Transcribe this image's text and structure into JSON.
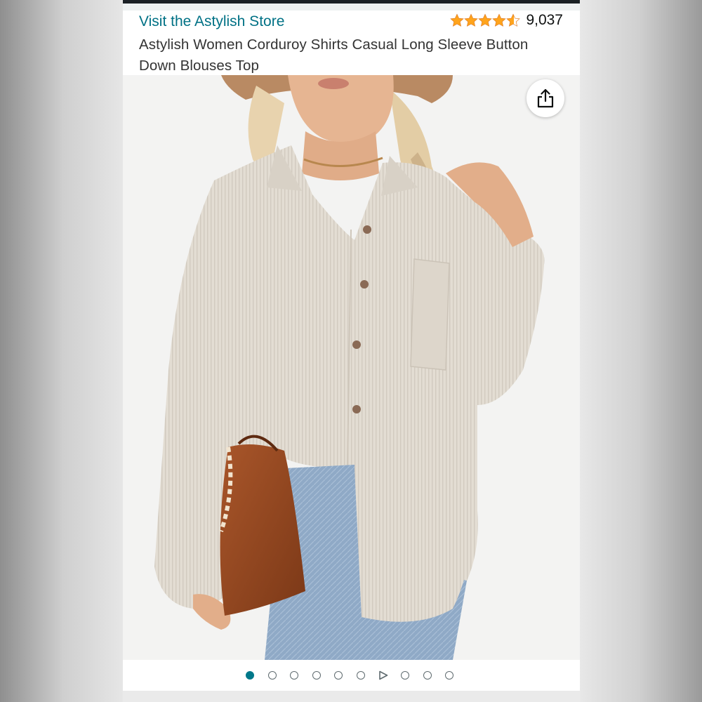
{
  "header": {
    "store_link": "Visit the Astylish Store",
    "rating_stars": 4.5,
    "rating_count": "9,037",
    "title": "Astylish Women Corduroy Shirts Casual Long Sleeve Button Down Blouses Top"
  },
  "icons": {
    "share": "share-icon",
    "star": "star-icon"
  },
  "carousel": {
    "active_index": 0,
    "items": [
      "image",
      "image",
      "image",
      "image",
      "image",
      "image",
      "video",
      "image",
      "image",
      "image"
    ]
  },
  "colors": {
    "link": "#007185",
    "star": "#ffa41c",
    "active_dot": "#00788a"
  }
}
